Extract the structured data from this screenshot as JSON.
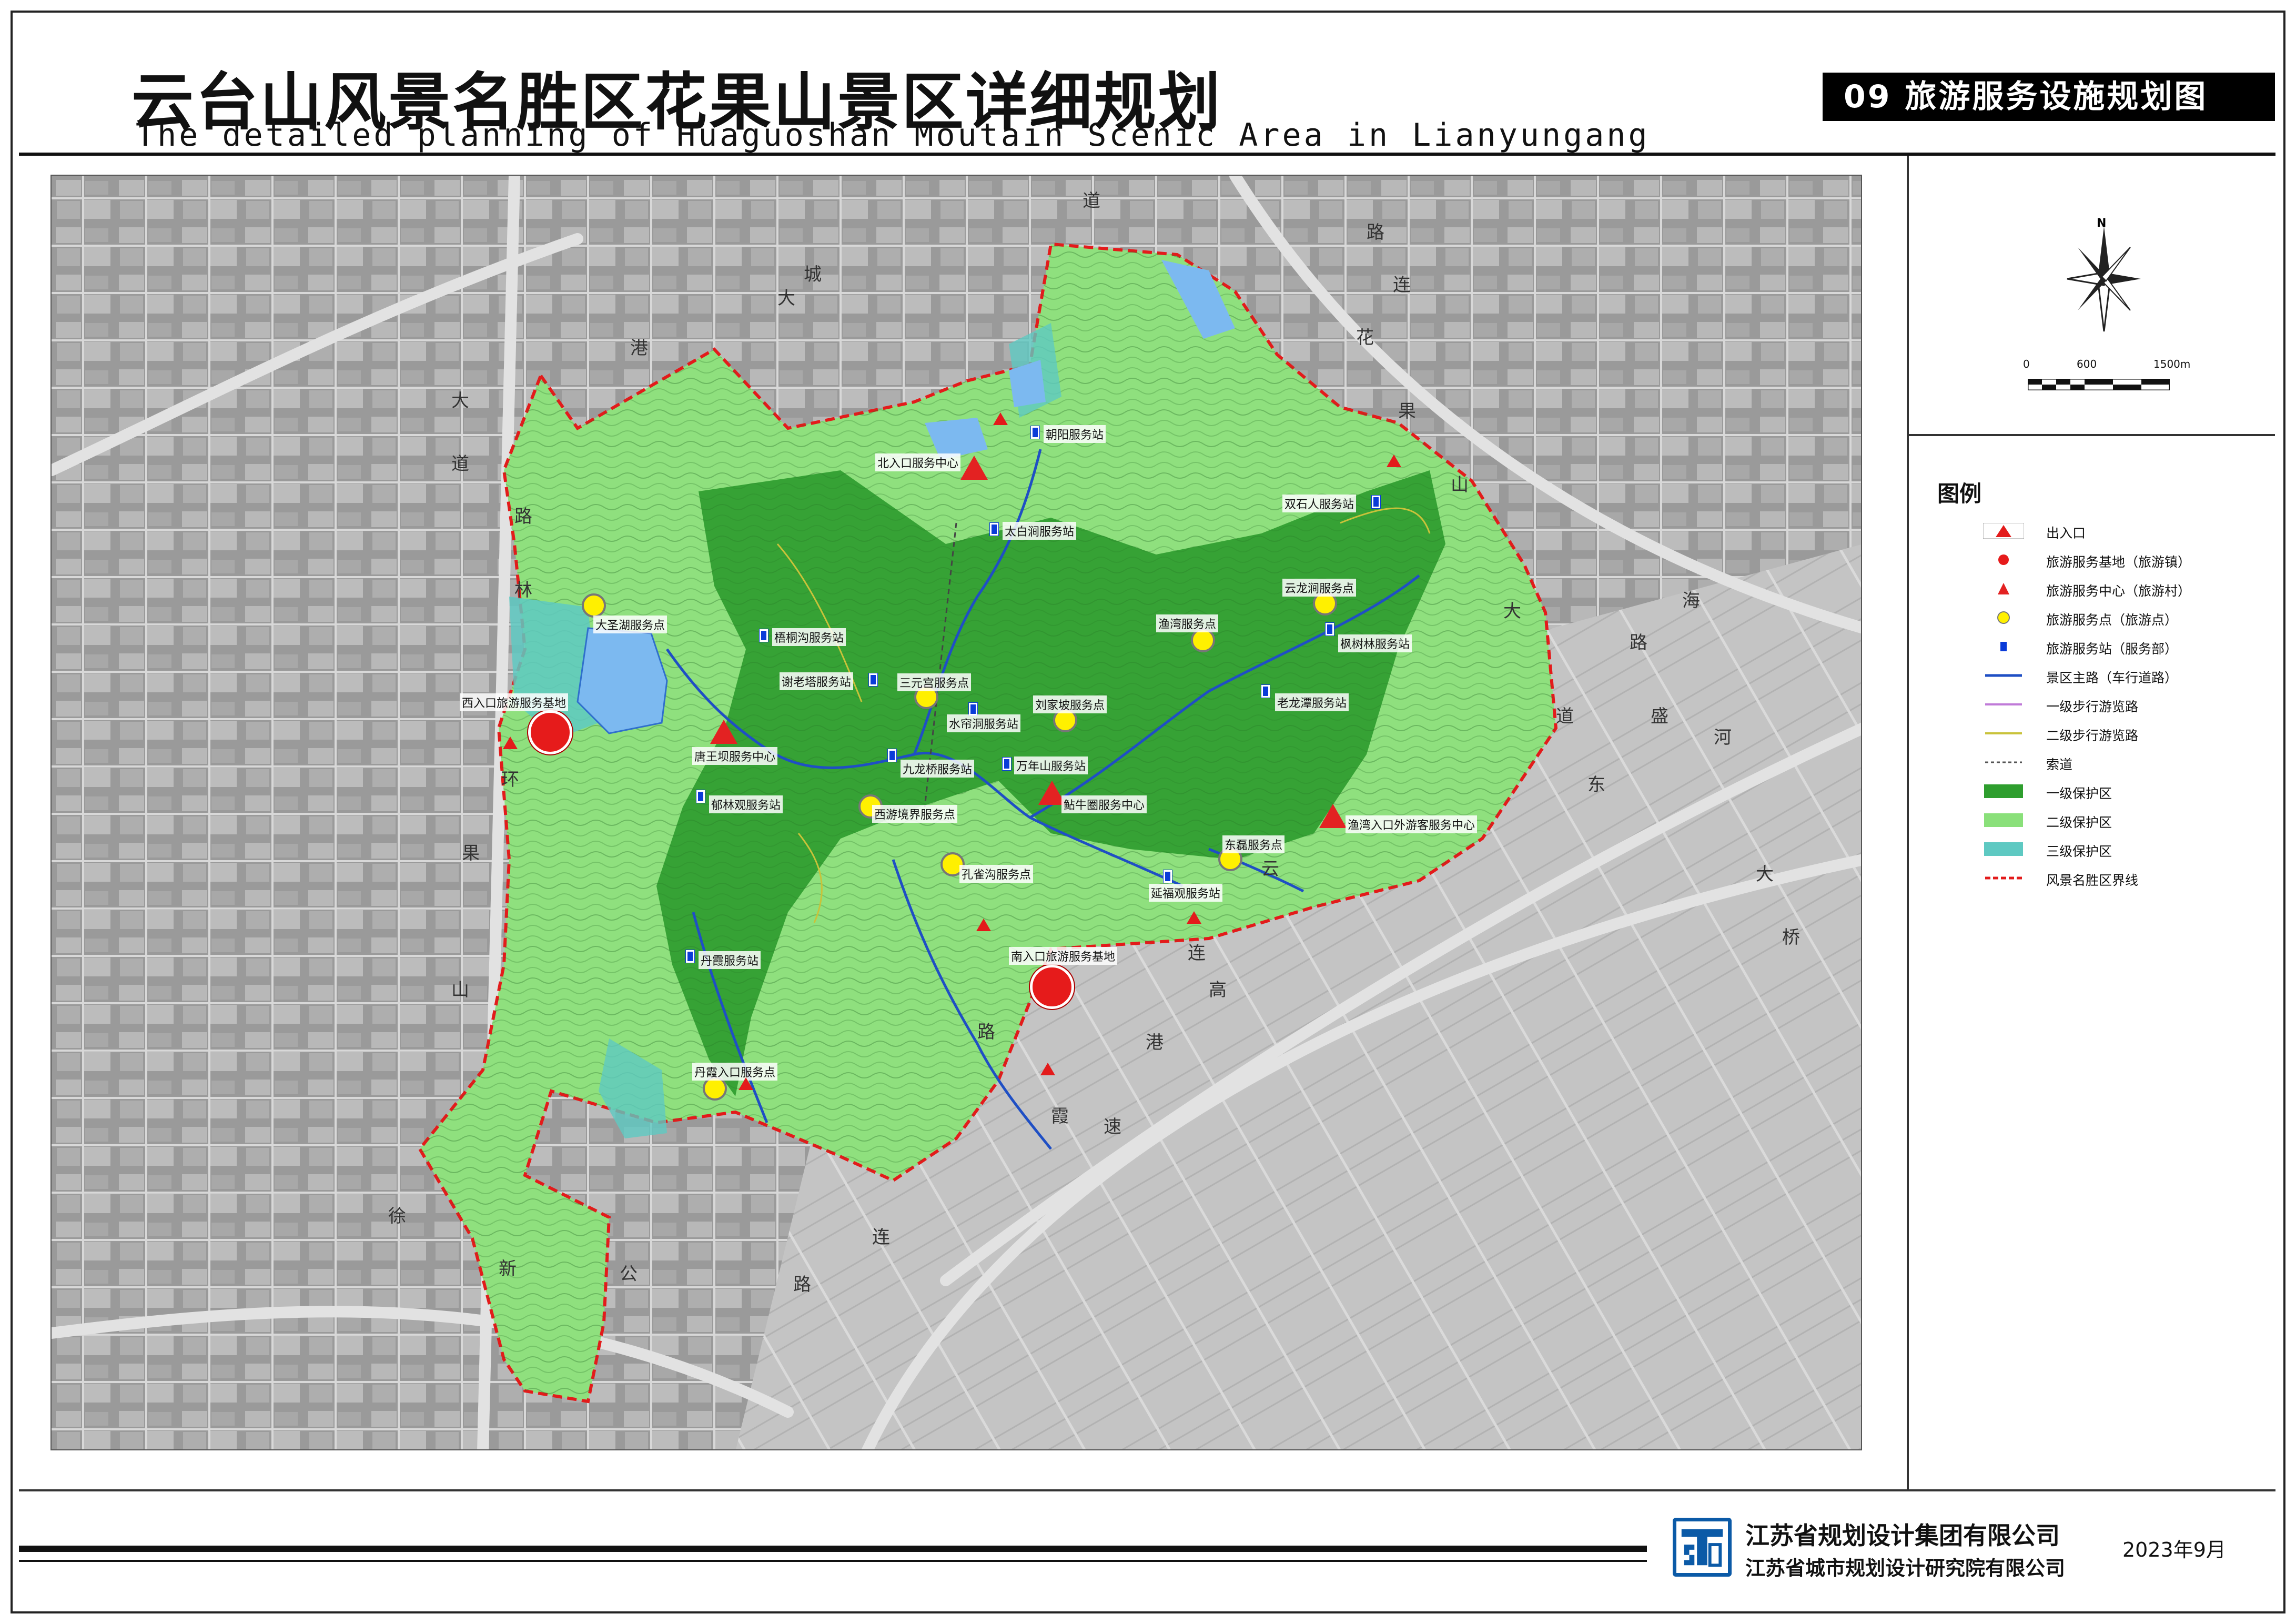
{
  "title": {
    "cn": "云台山风景名胜区花果山景区详细规划",
    "en": "The detailed planning of Huaguoshan Moutain Scenic Area in Lianyungang"
  },
  "sheet_label": "09 旅游服务设施规划图",
  "compass": {
    "north": "N"
  },
  "scale": {
    "labels": [
      "0",
      "600",
      "1500m"
    ]
  },
  "legend": {
    "title": "图例",
    "items": [
      {
        "symbol": "entry-marker",
        "label": "出入口",
        "color": "#e31b1b"
      },
      {
        "symbol": "red-circle",
        "label": "旅游服务基地（旅游镇）",
        "color": "#e61b1b"
      },
      {
        "symbol": "red-triangle",
        "label": "旅游服务中心（旅游村）",
        "color": "#e32222"
      },
      {
        "symbol": "yellow-circle",
        "label": "旅游服务点（旅游点）",
        "color": "#fff000"
      },
      {
        "symbol": "blue-square",
        "label": "旅游服务站（服务部）",
        "color": "#0a3bd8"
      },
      {
        "symbol": "line-blue",
        "label": "景区主路（车行道路）",
        "color": "#1f4fc4"
      },
      {
        "symbol": "line-purple",
        "label": "一级步行游览路",
        "color": "#c07ad8"
      },
      {
        "symbol": "line-yellow",
        "label": "二级步行游览路",
        "color": "#c9c23a"
      },
      {
        "symbol": "line-dash",
        "label": "索道",
        "color": "#555555"
      },
      {
        "symbol": "fill-dark-green",
        "label": "一级保护区",
        "color": "#2e9e2e"
      },
      {
        "symbol": "fill-light-green",
        "label": "二级保护区",
        "color": "#8ae07a"
      },
      {
        "symbol": "fill-teal",
        "label": "三级保护区",
        "color": "#5ec9c2"
      },
      {
        "symbol": "line-red-dash",
        "label": "风景名胜区界线",
        "color": "#e31b1b"
      }
    ]
  },
  "map": {
    "base_bases": [
      {
        "name": "西入口旅游服务基地"
      },
      {
        "name": "南入口旅游服务基地"
      }
    ],
    "centers": [
      {
        "name": "北入口服务中心"
      },
      {
        "name": "唐王坝服务中心"
      },
      {
        "name": "鲇牛圈服务中心"
      },
      {
        "name": "渔湾入口外游客服务中心"
      }
    ],
    "service_points": [
      {
        "name": "大圣湖服务点"
      },
      {
        "name": "三元宫服务点"
      },
      {
        "name": "刘家坡服务点"
      },
      {
        "name": "渔湾服务点"
      },
      {
        "name": "云龙涧服务点"
      },
      {
        "name": "西游境界服务点"
      },
      {
        "name": "孔雀沟服务点"
      },
      {
        "name": "东磊服务点"
      },
      {
        "name": "丹霞入口服务点"
      }
    ],
    "service_stations": [
      {
        "name": "朝阳服务站"
      },
      {
        "name": "太白涧服务站"
      },
      {
        "name": "双石人服务站"
      },
      {
        "name": "梧桐沟服务站"
      },
      {
        "name": "谢老塔服务站"
      },
      {
        "name": "水帘洞服务站"
      },
      {
        "name": "九龙桥服务站"
      },
      {
        "name": "万年山服务站"
      },
      {
        "name": "枫树林服务站"
      },
      {
        "name": "老龙潭服务站"
      },
      {
        "name": "郁林观服务站"
      },
      {
        "name": "延福观服务站"
      },
      {
        "name": "丹霞服务站"
      }
    ],
    "road_labels": [
      "大",
      "道",
      "城",
      "港",
      "路",
      "林",
      "环",
      "果",
      "山",
      "大",
      "道",
      "徐",
      "新",
      "公",
      "路",
      "连",
      "霞",
      "花",
      "果",
      "山",
      "大",
      "道",
      "连",
      "云",
      "港",
      "高",
      "速",
      "路",
      "东",
      "盛",
      "路",
      "河",
      "大",
      "桥",
      "海",
      "连",
      "路"
    ]
  },
  "footer": {
    "company1": "江苏省规划设计集团有限公司",
    "company2": "江苏省城市规划设计研究院有限公司",
    "date": "2023年9月"
  }
}
